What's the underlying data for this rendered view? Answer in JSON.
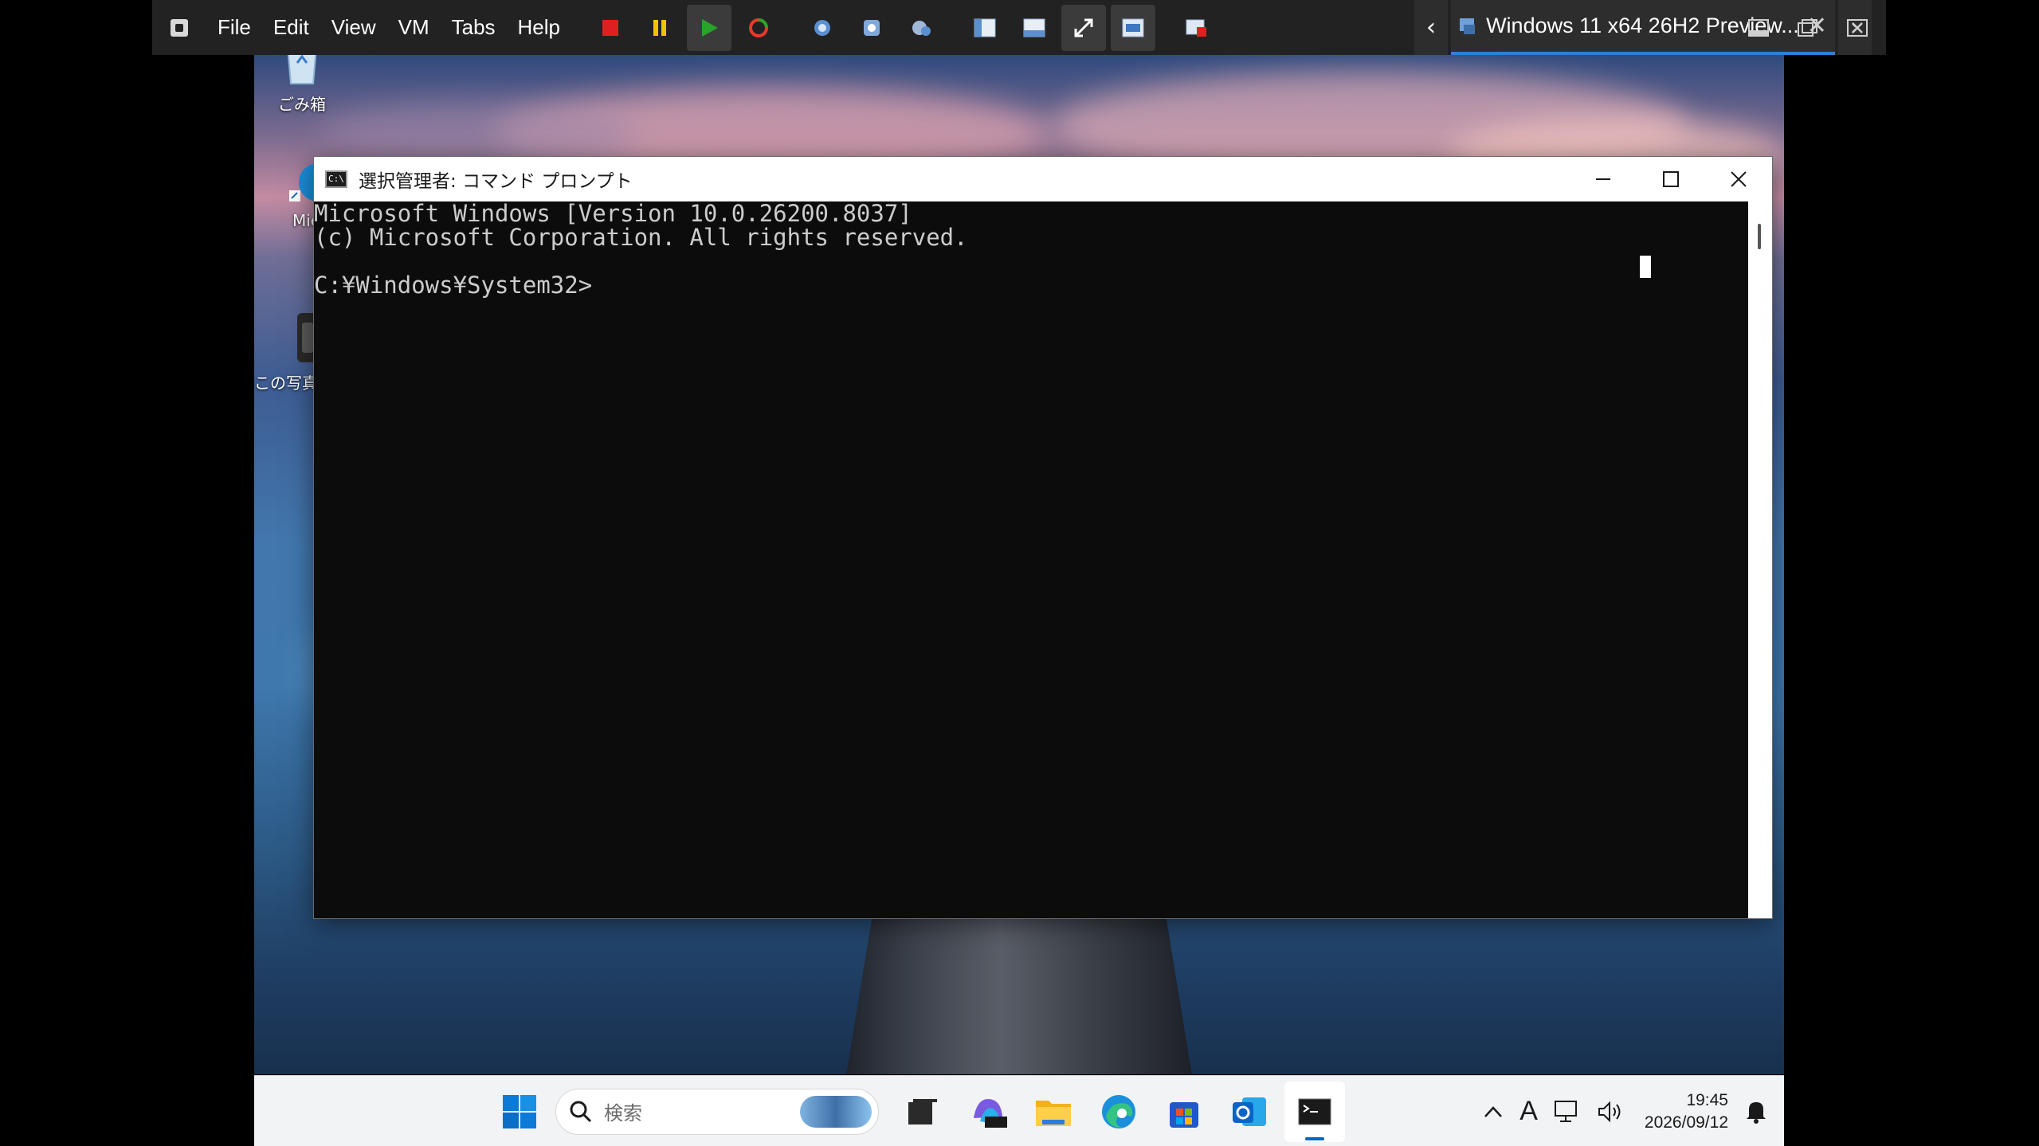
{
  "host": {
    "menu": [
      "File",
      "Edit",
      "View",
      "VM",
      "Tabs",
      "Help"
    ],
    "tab_title": "Windows 11 x64 26H2 Preview...",
    "colors": {
      "toolbar_bg": "#222222",
      "tab_accent": "#2f7fd8"
    }
  },
  "desktop": {
    "icons": [
      {
        "label": "ごみ箱",
        "icon": "recycle-bin-icon"
      },
      {
        "label": "Micr",
        "icon": "edge-shortcut-icon"
      },
      {
        "label": "この写真",
        "icon": "photo-shortcut-icon"
      }
    ]
  },
  "cmd": {
    "title": "選択管理者: コマンド プロンプト",
    "lines": [
      "Microsoft Windows [Version 10.0.26200.8037]",
      "(c) Microsoft Corporation. All rights reserved.",
      "",
      "C:¥Windows¥System32>"
    ]
  },
  "taskbar": {
    "search_placeholder": "検索",
    "time": "19:45",
    "date": "2026/09/12",
    "ime": "A",
    "apps": [
      "task-view",
      "m365-copilot",
      "file-explorer",
      "edge",
      "microsoft-store",
      "outlook",
      "terminal"
    ]
  }
}
